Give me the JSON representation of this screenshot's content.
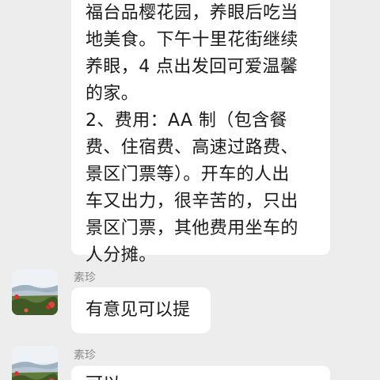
{
  "messages": [
    {
      "lines": [
        "福台品樱花园，养眼后吃当",
        "地美食。下午十里花街继续",
        "养眼，4 点出发回可爱温馨",
        "的家。",
        "2、费用：AA 制（包含餐",
        "费、住宿费、高速过路费、",
        "景区门票等）。开车的人出",
        "车又出力，很辛苦的，只出",
        "景区门票，其他费用坐车的",
        "人分摊。"
      ]
    },
    {
      "sender": "素珍",
      "text": "有意见可以提"
    },
    {
      "sender": "素珍",
      "text": "可以…"
    }
  ]
}
